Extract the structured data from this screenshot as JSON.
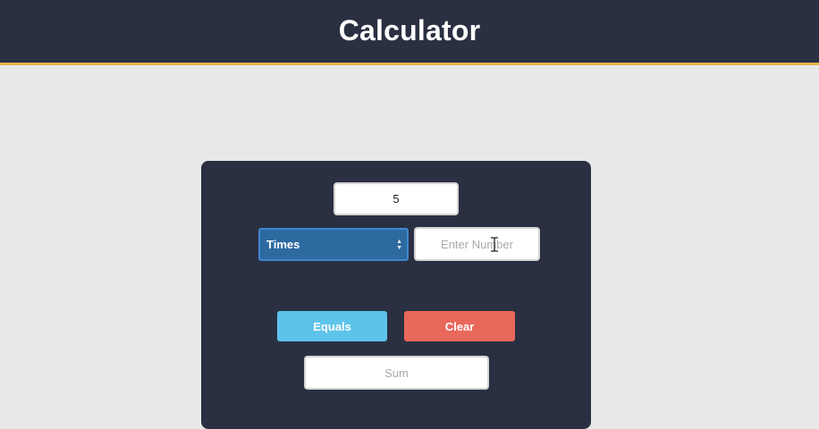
{
  "header": {
    "title": "Calculator"
  },
  "calculator": {
    "first_number": {
      "value": "5"
    },
    "operation": {
      "selected": "Times"
    },
    "second_number": {
      "value": "",
      "placeholder": "Enter Number"
    },
    "equals_label": "Equals",
    "clear_label": "Clear",
    "result": {
      "value": "",
      "placeholder": "Sum"
    }
  },
  "colors": {
    "header_bg": "#2a3042",
    "header_border": "#e6b24a",
    "page_bg": "#e8e8e8",
    "panel_bg": "#2a3042",
    "select_bg": "#2d6aa0",
    "equals_bg": "#5ec3ea",
    "clear_bg": "#e9685a"
  },
  "icons": {
    "cursor": "text-cursor-icon",
    "select_arrows": "select-arrows-icon"
  }
}
